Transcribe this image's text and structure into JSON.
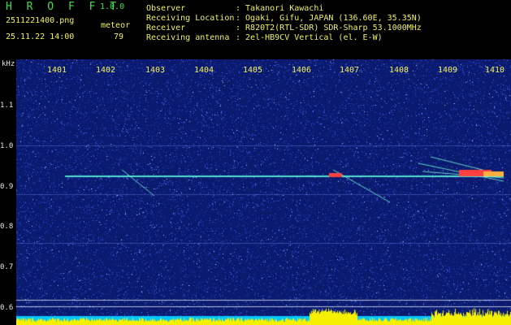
{
  "header": {
    "logo": "H R O F F T",
    "version": "1.0.0",
    "filename": "2511221400.png",
    "datetime": "25.11.22 14:00",
    "meteor_label": "meteor",
    "meteor_count": "79"
  },
  "info": {
    "observer_label": "Observer",
    "observer_value": ": Takanori Kawachi",
    "location_label": "Receiving Location",
    "location_value": ": Ogaki, Gifu, JAPAN (136.60E, 35.35N)",
    "receiver_label": "Receiver",
    "receiver_value": ": R820T2(RTL-SDR) SDR-Sharp 53.1000MHz",
    "antenna_label": "Receiving antenna",
    "antenna_value": ": 2el-HB9CV Vertical (el. E-W)"
  },
  "y_axis": {
    "unit": "kHz",
    "ticks": [
      "1.1",
      "1.0",
      "0.9",
      "0.8",
      "0.7",
      "0.6"
    ]
  },
  "x_axis": {
    "ticks": [
      "1401",
      "1402",
      "1403",
      "1404",
      "1405",
      "1406",
      "1407",
      "1408",
      "1409",
      "1410"
    ]
  },
  "colors": {
    "background": "#0a1a6e",
    "noise": "#3a5cff",
    "carrier": "#4fe0d0",
    "meteor_hot": "#ff4040",
    "level_bar": "#f5f000",
    "level_base": "#00c8ff"
  }
}
